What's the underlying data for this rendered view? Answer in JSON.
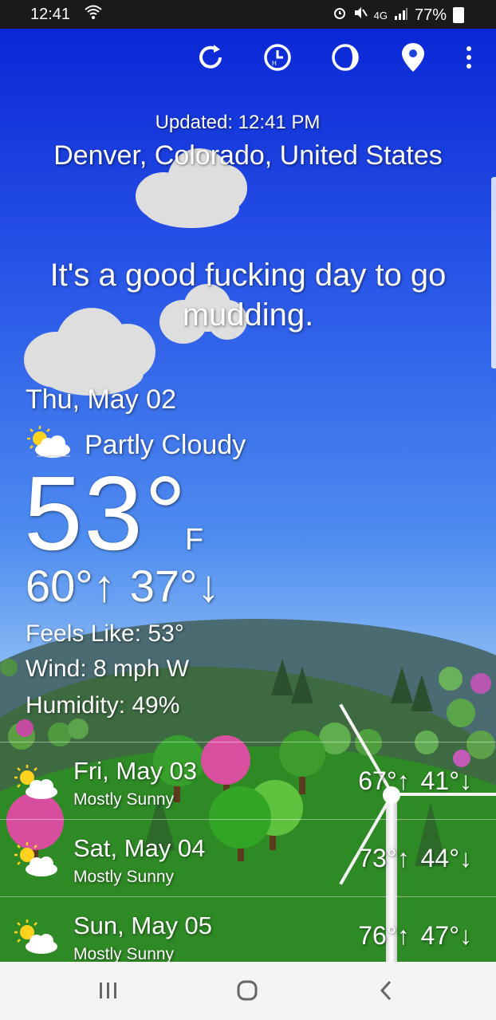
{
  "status_bar": {
    "time": "12:41",
    "network": "4G",
    "battery": "77%"
  },
  "toolbar": {
    "icons": [
      "refresh-icon",
      "history-icon",
      "moon-phase-icon",
      "location-pin-icon",
      "overflow-menu-icon"
    ]
  },
  "header": {
    "updated": "Updated: 12:41 PM",
    "location": "Denver, Colorado, United States"
  },
  "quote": "It's a good fucking day to go mudding.",
  "current": {
    "date": "Thu, May 02",
    "condition": "Partly Cloudy",
    "temperature": "53°",
    "unit": "F",
    "high": "60°",
    "low": "37°",
    "feels_like": "Feels Like: 53°",
    "wind": "Wind: 8 mph W",
    "humidity": "Humidity: 49%"
  },
  "forecast": [
    {
      "day": "Fri, May 03",
      "condition": "Mostly Sunny",
      "high": "67°",
      "low": "41°"
    },
    {
      "day": "Sat, May 04",
      "condition": "Mostly Sunny",
      "high": "73°",
      "low": "44°"
    },
    {
      "day": "Sun, May 05",
      "condition": "Mostly Sunny",
      "high": "76°",
      "low": "47°"
    }
  ],
  "colors": {
    "sky_top": "#0b27d6",
    "sky_bottom": "#9dc6f4",
    "grass": "#2e8a25",
    "text": "#ffffff"
  }
}
